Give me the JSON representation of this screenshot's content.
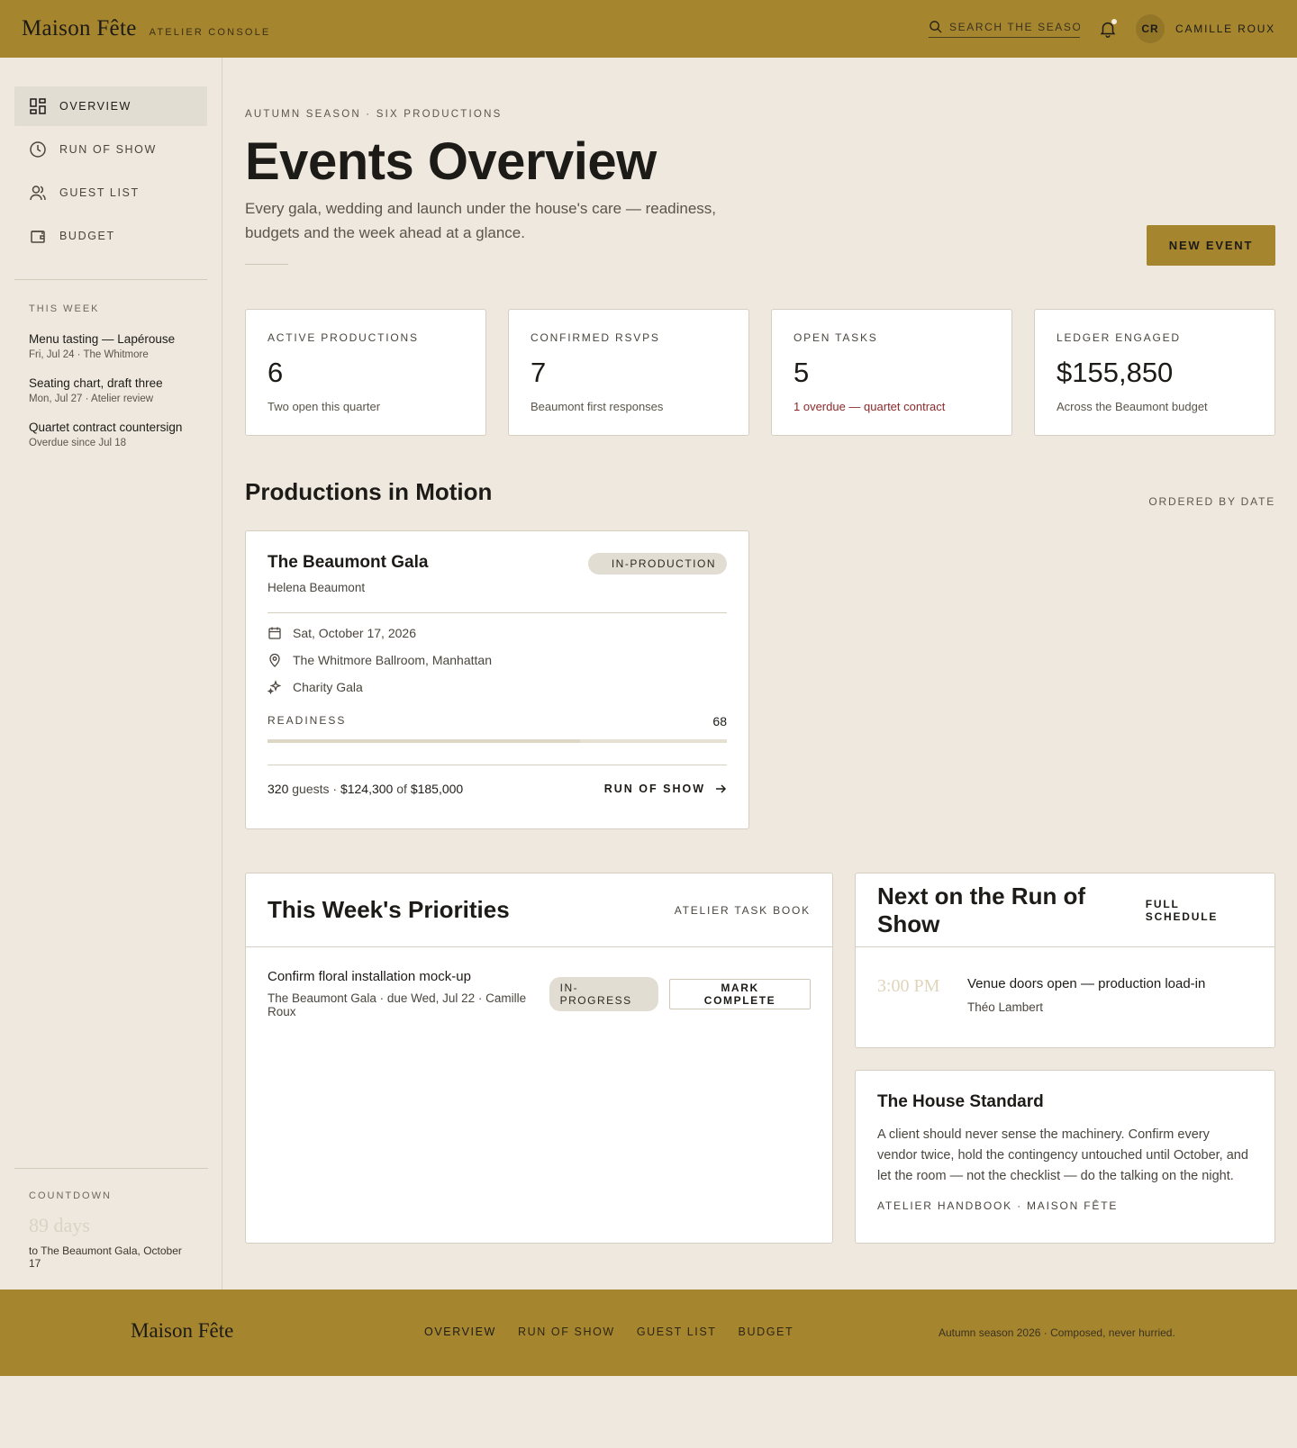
{
  "header": {
    "brand": "Maison Fête",
    "brand_sub": "ATELIER CONSOLE",
    "search_placeholder": "SEARCH THE SEASON",
    "avatar_initials": "CR",
    "user_name": "CAMILLE ROUX"
  },
  "sidebar": {
    "nav": [
      {
        "label": "OVERVIEW",
        "icon": "grid-icon",
        "active": true
      },
      {
        "label": "RUN OF SHOW",
        "icon": "clock-icon",
        "active": false
      },
      {
        "label": "GUEST LIST",
        "icon": "users-icon",
        "active": false
      },
      {
        "label": "BUDGET",
        "icon": "wallet-icon",
        "active": false
      }
    ],
    "week_heading": "THIS WEEK",
    "week_items": [
      {
        "title": "Menu tasting — Lapérouse",
        "meta": "Fri, Jul 24 · The Whitmore"
      },
      {
        "title": "Seating chart, draft three",
        "meta": "Mon, Jul 27 · Atelier review"
      },
      {
        "title": "Quartet contract countersign",
        "meta": "Overdue since Jul 18"
      }
    ],
    "countdown": {
      "label": "COUNTDOWN",
      "days": "89 days",
      "note": "to The Beaumont Gala, October 17"
    }
  },
  "main": {
    "eyebrow": "AUTUMN SEASON · SIX PRODUCTIONS",
    "title": "Events Overview",
    "intro": "Every gala, wedding and launch under the house's care — readiness, budgets and the week ahead at a glance.",
    "new_event_label": "NEW EVENT",
    "stats": [
      {
        "label": "ACTIVE PRODUCTIONS",
        "value": "6",
        "note": "Two open this quarter",
        "alert": false
      },
      {
        "label": "CONFIRMED RSVPS",
        "value": "7",
        "note": "Beaumont first responses",
        "alert": false
      },
      {
        "label": "OPEN TASKS",
        "value": "5",
        "note": "1 overdue — quartet contract",
        "alert": true
      },
      {
        "label": "LEDGER ENGAGED",
        "value": "$155,850",
        "note": "Across the Beaumont budget",
        "alert": false
      }
    ],
    "productions": {
      "title": "Productions in Motion",
      "meta": "ORDERED BY DATE",
      "card": {
        "name": "The Beaumont Gala",
        "client": "Helena Beaumont",
        "status": "IN-PRODUCTION",
        "date": "Sat, October 17, 2026",
        "venue": "The Whitmore Ballroom, Manhattan",
        "type": "Charity Gala",
        "readiness_label": "READINESS",
        "readiness_value": "68",
        "guests": "320",
        "guests_word": "guests",
        "sep": "·",
        "spent": "$124,300",
        "of_word": "of",
        "budget": "$185,000",
        "link_label": "RUN OF SHOW"
      }
    },
    "priorities": {
      "title": "This Week's Priorities",
      "meta": "ATELIER TASK BOOK",
      "tasks": [
        {
          "title": "Confirm floral installation mock-up",
          "meta": "The Beaumont Gala · due Wed, Jul 22 · Camille Roux",
          "status": "IN-PROGRESS",
          "action": "MARK COMPLETE"
        }
      ]
    },
    "run_of_show": {
      "title": "Next on the Run of Show",
      "meta": "FULL SCHEDULE",
      "items": [
        {
          "time": "3:00 PM",
          "title": "Venue doors open — production load-in",
          "who": "Théo Lambert"
        }
      ]
    },
    "house_standard": {
      "title": "The House Standard",
      "text": "A client should never sense the machinery. Confirm every vendor twice, hold the contingency untouched until October, and let the room — not the checklist — do the talking on the night.",
      "signature": "ATELIER HANDBOOK · MAISON FÊTE"
    }
  },
  "footer": {
    "brand": "Maison Fête",
    "nav": [
      "OVERVIEW",
      "RUN OF SHOW",
      "GUEST LIST",
      "BUDGET"
    ],
    "note": "Autumn season 2026 · Composed, never hurried."
  },
  "colors": {
    "accent": "#A6852F",
    "background": "#EEE8DE",
    "alert": "#8A2A2A"
  }
}
